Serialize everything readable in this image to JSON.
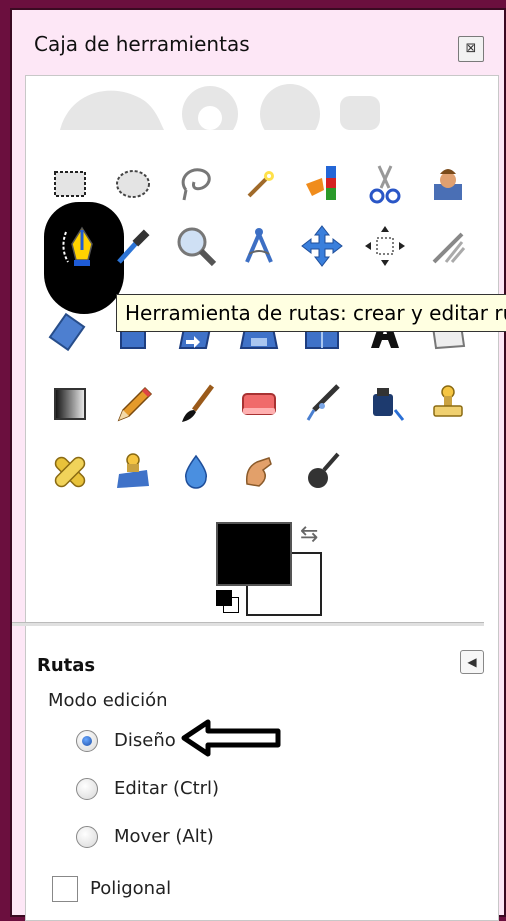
{
  "window": {
    "title": "Caja de herramientas",
    "close_glyph": "⊠"
  },
  "tooltip": {
    "text": "Herramienta de rutas: crear y editar ru"
  },
  "tools": [
    [
      "rect-select-icon",
      "ellipse-select-icon",
      "free-select-icon",
      "fuzzy-select-icon",
      "select-by-color-icon",
      "scissors-select-icon",
      "foreground-select-icon"
    ],
    [
      "paths-tool-icon",
      "color-picker-icon",
      "zoom-icon",
      "measure-icon",
      "move-icon",
      "alignment-icon",
      "crop-icon"
    ],
    [
      "rotate-icon",
      "scale-icon",
      "shear-icon",
      "perspective-icon",
      "flip-icon",
      "text-icon",
      "cage-transform-icon"
    ],
    [
      "blend-icon",
      "pencil-icon",
      "paintbrush-icon",
      "eraser-icon",
      "airbrush-icon",
      "ink-icon",
      "clone-icon"
    ],
    [
      "heal-icon",
      "perspective-clone-icon",
      "blur-icon",
      "smudge-icon",
      "dodge-burn-icon"
    ]
  ],
  "colors": {
    "foreground": "#000000",
    "background": "#ffffff",
    "swap_glyph": "⇆"
  },
  "tool_options": {
    "title": "Rutas",
    "menu_glyph": "◀",
    "edit_mode_label": "Modo edición",
    "modes": [
      {
        "label": "Diseño",
        "checked": true
      },
      {
        "label": "Editar (Ctrl)",
        "checked": false
      },
      {
        "label": "Mover (Alt)",
        "checked": false
      }
    ],
    "polygonal_label": "Poligonal",
    "polygonal_checked": false
  }
}
